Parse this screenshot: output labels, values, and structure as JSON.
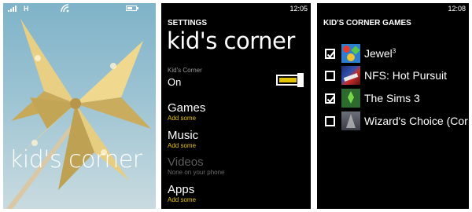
{
  "lockscreen": {
    "status": {
      "network": "H"
    },
    "title": "kid's corner"
  },
  "settings": {
    "status": {
      "time": "12:05"
    },
    "header": "SETTINGS",
    "title": "kid's corner",
    "toggle": {
      "caption": "Kid's Corner",
      "state": "On",
      "on": true
    },
    "items": [
      {
        "label": "Games",
        "sub": "Add some",
        "enabled": true
      },
      {
        "label": "Music",
        "sub": "Add some",
        "enabled": true
      },
      {
        "label": "Videos",
        "sub": "None on your phone",
        "enabled": false
      },
      {
        "label": "Apps",
        "sub": "Add some",
        "enabled": true
      }
    ]
  },
  "games": {
    "status": {
      "time": "12:08"
    },
    "header": "KID'S CORNER GAMES",
    "list": [
      {
        "name": "Jewel",
        "sup": "3",
        "checked": true,
        "icon": "jewel-icon"
      },
      {
        "name": "NFS: Hot Pursuit",
        "sup": "",
        "checked": false,
        "icon": "nfs-icon"
      },
      {
        "name": "The Sims 3",
        "sup": "",
        "checked": true,
        "icon": "sims-icon"
      },
      {
        "name": "Wizard's Choice (Cor",
        "sup": "",
        "checked": false,
        "icon": "wizard-icon"
      }
    ]
  },
  "colors": {
    "accent": "#e3c300",
    "background": "#000000",
    "text": "#ffffff"
  }
}
